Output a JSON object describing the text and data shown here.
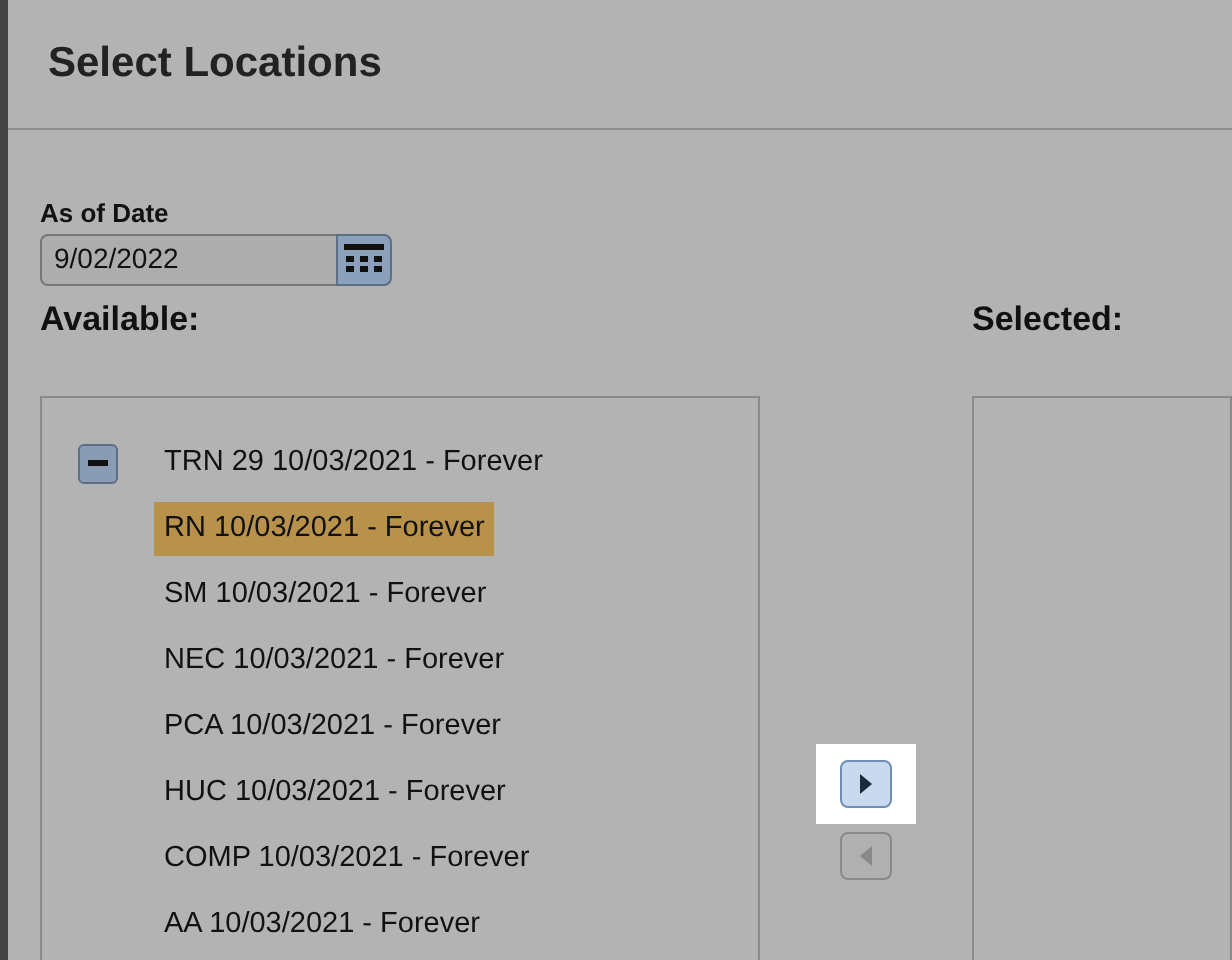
{
  "window": {
    "title": "Select Locations"
  },
  "as_of_date": {
    "label": "As of Date",
    "value": "9/02/2022"
  },
  "available": {
    "label": "Available:",
    "tree": [
      {
        "label": "TRN 29 10/03/2021 - Forever",
        "expanded": true,
        "selected": false,
        "children": [
          {
            "label": "RN 10/03/2021 - Forever",
            "selected": true
          },
          {
            "label": "SM 10/03/2021 - Forever",
            "selected": false
          },
          {
            "label": "NEC 10/03/2021 - Forever",
            "selected": false
          },
          {
            "label": "PCA 10/03/2021 - Forever",
            "selected": false
          },
          {
            "label": "HUC 10/03/2021 - Forever",
            "selected": false
          },
          {
            "label": "COMP 10/03/2021 - Forever",
            "selected": false
          },
          {
            "label": "AA 10/03/2021 - Forever",
            "selected": false
          }
        ]
      }
    ]
  },
  "move_buttons": [
    {
      "kind": "add",
      "disabled": false,
      "highlighted": true
    },
    {
      "kind": "remove",
      "disabled": true,
      "highlighted": false
    }
  ],
  "selected": {
    "label": "Selected:"
  }
}
